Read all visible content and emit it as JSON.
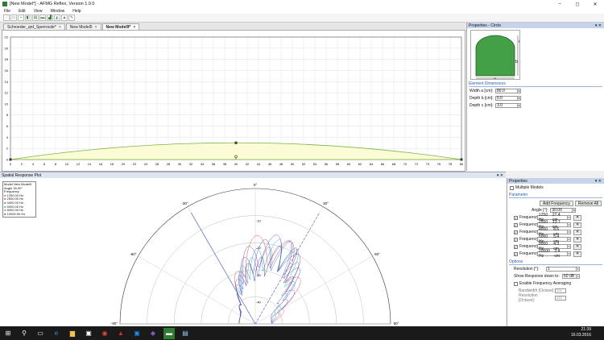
{
  "window": {
    "title": "[New Model*] - AFMG Reflex, Version 1.0.0"
  },
  "menu": [
    "File",
    "Edit",
    "View",
    "Window",
    "Help"
  ],
  "toolbar_icons": [
    "new-file-icon",
    "open-icon",
    "save-icon",
    "model-icon",
    "chart-icon",
    "shape-icon",
    "shape2-icon",
    "shape3-icon",
    "shape4-icon",
    "settings-icon"
  ],
  "tabs": [
    {
      "label": "Schroeder_qrd_Sperrocde*"
    },
    {
      "label": "New Model5"
    },
    {
      "label": "New Model9*"
    }
  ],
  "model_view": {
    "y_ticks": [
      "22",
      "20",
      "18",
      "16",
      "14",
      "12",
      "10",
      "8",
      "6",
      "4",
      "2",
      "0"
    ],
    "x_ticks": [
      "0",
      "2",
      "4",
      "6",
      "8",
      "10",
      "12",
      "14",
      "16",
      "18",
      "20",
      "22",
      "24",
      "26",
      "28",
      "30",
      "32",
      "34",
      "36",
      "38",
      "40",
      "42",
      "44",
      "46",
      "48",
      "50",
      "52",
      "54",
      "56",
      "58",
      "60",
      "62",
      "64",
      "66",
      "68",
      "70",
      "72",
      "74",
      "76",
      "78",
      "80"
    ]
  },
  "properties": {
    "header": "Properties - Circle",
    "shape_labels": {
      "a": "a",
      "b": "b",
      "c": "c"
    },
    "section": "Element Dimensions",
    "fields": [
      {
        "label": "Width a [cm]:",
        "value": "80.0"
      },
      {
        "label": "Depth b [cm]:",
        "value": "0.0"
      },
      {
        "label": "Depth c [cm]:",
        "value": "3.0"
      }
    ]
  },
  "spatial": {
    "header": "Spatial Response Plot",
    "legend": {
      "model_label": "Model",
      "model_value": "New Model9",
      "angle_label": "Angle",
      "angle_value": "30.00°",
      "freq_label": "Frequency",
      "entries": [
        {
          "text": "1250.00 Hz",
          "color": "#e53935"
        },
        {
          "text": "2500.00 Hz",
          "color": "#8e24aa"
        },
        {
          "text": "4000.00 Hz",
          "color": "#3949ab"
        },
        {
          "text": "5000.00 Hz",
          "color": "#00acc1"
        },
        {
          "text": "8000.00 Hz",
          "color": "#5c6bc0"
        },
        {
          "text": "10000.00 Hz",
          "color": "#283593"
        }
      ]
    },
    "angle_labels": [
      "0°",
      "30°",
      "-30°",
      "60°",
      "-60°",
      "90°",
      "-90°"
    ],
    "db_labels": [
      "-10",
      "-20",
      "-30",
      "-40",
      "-50"
    ]
  },
  "rprops": {
    "header": "Properties",
    "multiple_models": "Multiple Models",
    "parameter": "Parameter",
    "add_frequency": "Add Frequency",
    "remove_all": "Remove All",
    "angle_label": "Angle [°]:",
    "angle_value": "30.00",
    "frequencies": [
      {
        "label": "Frequency:",
        "hz": "1250 Hz",
        "len": "27.4 cm"
      },
      {
        "label": "Frequency:",
        "hz": "2500 Hz",
        "len": "13.7 cm"
      },
      {
        "label": "Frequency:",
        "hz": "4000 Hz",
        "len": "8.6 cm"
      },
      {
        "label": "Frequency:",
        "hz": "5000 Hz",
        "len": "5.4 cm"
      },
      {
        "label": "Frequency:",
        "hz": "8000 Hz",
        "len": "4.3 cm"
      },
      {
        "label": "Frequency:",
        "hz": "10000 Hz",
        "len": "3.4 cm"
      }
    ],
    "options": "Options",
    "resolution_label": "Resolution [°]:",
    "resolution_value": "1",
    "show_response_label": "Show Response down to:",
    "show_response_value": "60 dB",
    "enable_averaging": "Enable Frequency Averaging",
    "bandwidth_label": "Bandwidth [Octave]:",
    "bandwidth_value": "1/1",
    "res_octave_label": "Resolution [Octave]:",
    "res_octave_value": "1/3"
  },
  "taskbar": {
    "time": "21:39",
    "date": "16.03.2016"
  }
}
